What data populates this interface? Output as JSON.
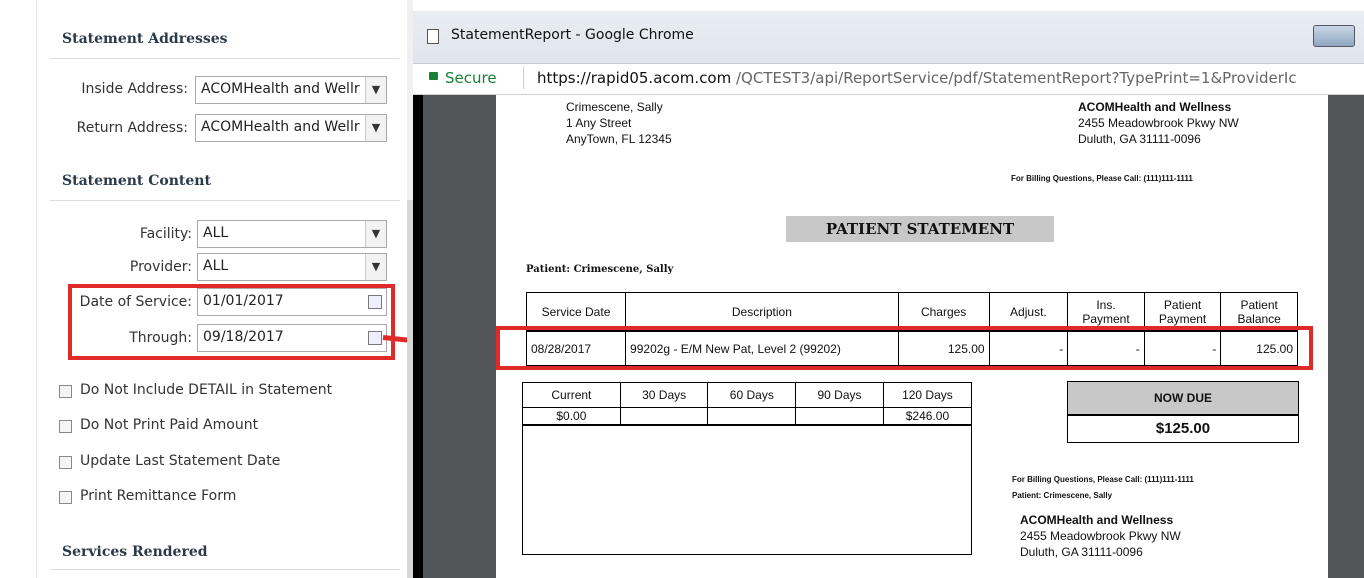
{
  "left_panel": {
    "statement_addresses": {
      "heading": "Statement Addresses",
      "inside_label": "Inside Address:",
      "inside_value": "ACOMHealth and Wellr",
      "return_label": "Return Address:",
      "return_value": "ACOMHealth and Wellr"
    },
    "statement_content": {
      "heading": "Statement Content",
      "facility_label": "Facility:",
      "facility_value": "ALL",
      "provider_label": "Provider:",
      "provider_value": "ALL",
      "dos_label": "Date of Service:",
      "dos_value": "01/01/2017",
      "through_label": "Through:",
      "through_value": "09/18/2017"
    },
    "checkboxes": [
      "Do Not Include DETAIL in Statement",
      "Do Not Print Paid Amount",
      "Update Last Statement Date",
      "Print Remittance Form"
    ],
    "services_heading": "Services Rendered"
  },
  "browser": {
    "title": "StatementReport - Google Chrome",
    "secure_label": "Secure",
    "url_host": "https://rapid05.acom.com",
    "url_path": "/QCTEST3/api/ReportService/pdf/StatementReport?TypePrint=1&ProviderIc"
  },
  "statement": {
    "patient_address": [
      "Crimescene, Sally",
      "1 Any Street",
      "AnyTown, FL 12345"
    ],
    "provider_name": "ACOMHealth and Wellness",
    "provider_address": [
      "2455  Meadowbrook Pkwy NW",
      "Duluth, GA 31111-0096"
    ],
    "billing_questions": "For Billing Questions, Please Call: (111)111-1111",
    "title": "PATIENT STATEMENT",
    "patient_line": "Patient:  Crimescene, Sally",
    "headers": [
      "Service Date",
      "Description",
      "Charges",
      "Adjust.",
      "Ins. Payment",
      "Patient Payment",
      "Patient Balance"
    ],
    "row": [
      "08/28/2017",
      "99202g - E/M New Pat, Level 2 (99202)",
      "125.00",
      "-",
      "-",
      "-",
      "125.00"
    ],
    "aging_headers": [
      "Current",
      "30 Days",
      "60 Days",
      "90 Days",
      "120 Days"
    ],
    "aging_values": [
      "$0.00",
      "",
      "",
      "",
      "$246.00"
    ],
    "now_due_label": "NOW DUE",
    "now_due_value": "$125.00",
    "remit_billing": "For Billing Questions, Please Call: (111)111-1111",
    "remit_patient": "Patient: Crimescene, Sally",
    "remit_provider": "ACOMHealth and Wellness",
    "remit_address": [
      "2455  Meadowbrook Pkwy NW",
      "Duluth, GA 31111-0096"
    ]
  },
  "colors": {
    "highlight": "#e02a2a",
    "section_heading": "#2b3a4a"
  }
}
